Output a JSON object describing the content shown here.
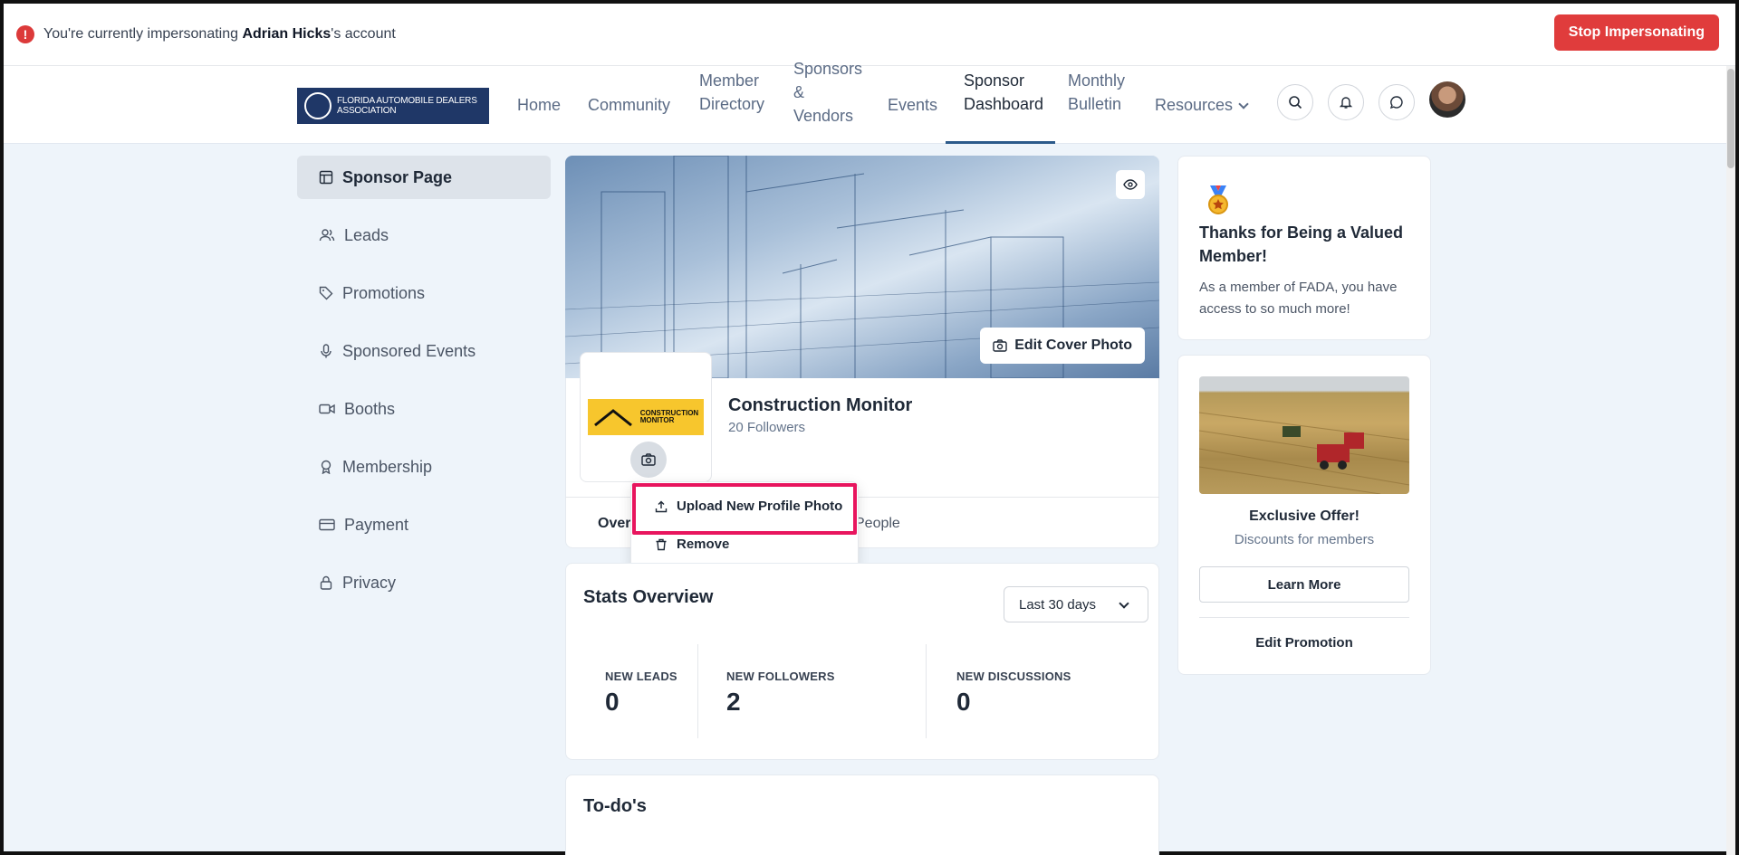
{
  "impersonation": {
    "prefix": "You're currently impersonating ",
    "user": "Adrian Hicks",
    "suffix": "'s account",
    "stop_label": "Stop Impersonating"
  },
  "logo": {
    "text": "FLORIDA AUTOMOBILE DEALERS ASSOCIATION"
  },
  "nav": {
    "home": "Home",
    "community": "Community",
    "member_line1": "Member",
    "member_line2": "Directory",
    "sponsors_line1": "Sponsors",
    "sponsors_line2": "&",
    "sponsors_line3": "Vendors",
    "events": "Events",
    "dashboard_line1": "Sponsor",
    "dashboard_line2": "Dashboard",
    "bulletin_line1": "Monthly",
    "bulletin_line2": "Bulletin",
    "resources": "Resources"
  },
  "sidebar": {
    "items": [
      {
        "label": "Sponsor Page",
        "icon": "layout-icon"
      },
      {
        "label": "Leads",
        "icon": "users-icon"
      },
      {
        "label": "Promotions",
        "icon": "tag-icon"
      },
      {
        "label": "Sponsored Events",
        "icon": "microphone-icon"
      },
      {
        "label": "Booths",
        "icon": "video-icon"
      },
      {
        "label": "Membership",
        "icon": "award-icon"
      },
      {
        "label": "Payment",
        "icon": "credit-card-icon"
      },
      {
        "label": "Privacy",
        "icon": "lock-icon"
      }
    ]
  },
  "profile": {
    "edit_cover_label": "Edit Cover Photo",
    "logo_text_line1": "CONSTRUCTION",
    "logo_text_line2": "MONITOR",
    "company_name": "Construction Monitor",
    "followers": "20 Followers",
    "tabs": {
      "overview": "Overv",
      "people": "People"
    }
  },
  "photo_menu": {
    "upload_label": "Upload New Profile Photo",
    "remove_label": "Remove"
  },
  "stats": {
    "title": "Stats Overview",
    "range": "Last 30 days",
    "items": [
      {
        "label": "NEW LEADS",
        "value": "0"
      },
      {
        "label": "NEW FOLLOWERS",
        "value": "2"
      },
      {
        "label": "NEW DISCUSSIONS",
        "value": "0"
      }
    ]
  },
  "todo": {
    "title": "To-do's"
  },
  "welcome": {
    "title": "Thanks for Being a Valued Member!",
    "text": "As a member of FADA, you have access to so much more!"
  },
  "promo": {
    "title": "Exclusive Offer!",
    "subtitle": "Discounts for members",
    "learn_label": "Learn More",
    "edit_label": "Edit Promotion"
  },
  "colors": {
    "accent": "#e03c3c",
    "brand": "#1f3767",
    "highlight": "#e8155e"
  }
}
